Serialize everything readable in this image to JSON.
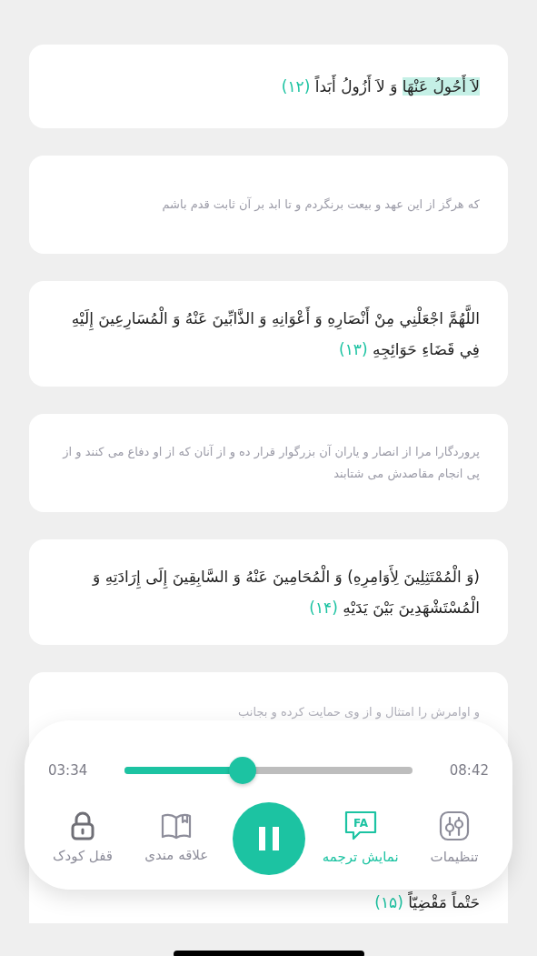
{
  "cards": [
    {
      "kind": "arabic",
      "segments": [
        {
          "text": "لاَ أَحُولُ عَنْهَا",
          "highlighted": true
        },
        {
          "text": " وَ لاَ أَزُولُ أَبَداً",
          "highlighted": false
        }
      ],
      "number": "(۱۲)"
    },
    {
      "kind": "translation",
      "text": "که هرگز از این عهد و بیعت برنگردم و تا ابد بر آن ثابت قدم باشم"
    },
    {
      "kind": "arabic",
      "segments": [
        {
          "text": "اللَّهُمَّ اجْعَلْنِي مِنْ أَنْصَارِهِ وَ أَعْوَانِهِ وَ الذَّابِّينَ عَنْهُ وَ الْمُسَارِعِينَ إِلَيْهِ فِي قَضَاءِ حَوَائِجِهِ",
          "highlighted": false
        }
      ],
      "number": "(۱۳)"
    },
    {
      "kind": "translation",
      "text": "پروردگارا مرا از انصار و یاران آن بزرگوار قرار ده و از آنان که از او دفاع می کنند و از پی انجام مقاصدش می شتابند"
    },
    {
      "kind": "arabic",
      "segments": [
        {
          "text": "(وَ الْمُمْتَثِلِينَ لِأَوَامِرِهِ) وَ الْمُحَامِينَ عَنْهُ وَ السَّابِقِينَ إِلَى إِرَادَتِهِ وَ الْمُسْتَشْهَدِينَ بَيْنَ يَدَيْهِ",
          "highlighted": false
        }
      ],
      "number": "(۱۴)"
    },
    {
      "kind": "partial",
      "text": "و اوامرش را امتثال و از وی حمایت کرده و بجانب",
      "tail": "حَتْماً مَقْضِيّاً",
      "number": "(۱۵)"
    }
  ],
  "player": {
    "elapsed": "03:34",
    "total": "08:42",
    "level": 0.41,
    "playing": true,
    "actions": [
      {
        "kind": "settings",
        "label": "تنظیمات",
        "on": false
      },
      {
        "kind": "translate",
        "label": "نمایش ترجمه",
        "on": true,
        "icon_text": "FA"
      },
      {
        "kind": "play"
      },
      {
        "kind": "book",
        "label": "علاقه مندی",
        "on": false
      },
      {
        "kind": "lock",
        "label": "قفل کودک",
        "on": false
      }
    ]
  }
}
